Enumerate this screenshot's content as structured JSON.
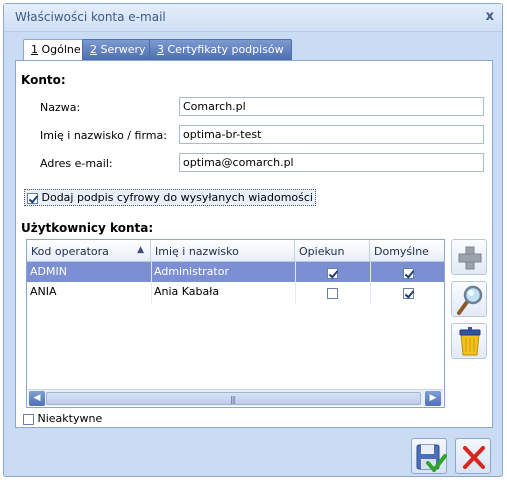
{
  "window": {
    "title": "Właściwości konta e-mail",
    "close_glyph": "x"
  },
  "tabs": [
    {
      "num": "1",
      "label": " Ogólne"
    },
    {
      "num": "2",
      "label": " Serwery"
    },
    {
      "num": "3",
      "label": " Certyfikaty podpisów"
    }
  ],
  "konto": {
    "heading": "Konto:",
    "nazwa_label": "Nazwa:",
    "nazwa_value": "Comarch.pl",
    "imie_label": "Imię i nazwisko / firma:",
    "imie_value": "optima-br-test",
    "adres_label": "Adres e-mail:",
    "adres_value": "optima@comarch.pl"
  },
  "signature": {
    "label": "Dodaj podpis cyfrowy do wysyłanych wiadomości",
    "checked": true
  },
  "users": {
    "heading": "Użytkownicy konta:",
    "columns": [
      "Kod operatora",
      "Imię i nazwisko",
      "Opiekun",
      "Domyślne"
    ],
    "sort_glyph": "▲",
    "rows": [
      {
        "kod": "ADMIN",
        "imie": "Administrator",
        "opiekun": true,
        "domyslne": true
      },
      {
        "kod": "ANIA",
        "imie": "Ania Kabała",
        "opiekun": false,
        "domyslne": true
      }
    ],
    "scroll_left": "◀",
    "scroll_right": "▶",
    "scroll_grip": "|||"
  },
  "side_buttons": [
    "plus-icon",
    "magnifier-icon",
    "trash-bin-icon"
  ],
  "inactive": {
    "label": "Nieaktywne",
    "checked": false
  },
  "buttons": {
    "save_icon": "floppy-check-icon",
    "cancel_icon": "red-x-icon"
  },
  "colors": {
    "selected_row": "#7d8fd3",
    "tab_active": "#ffffff",
    "tab_inactive": "#4c6db0",
    "cancel_red": "#d9261c"
  }
}
